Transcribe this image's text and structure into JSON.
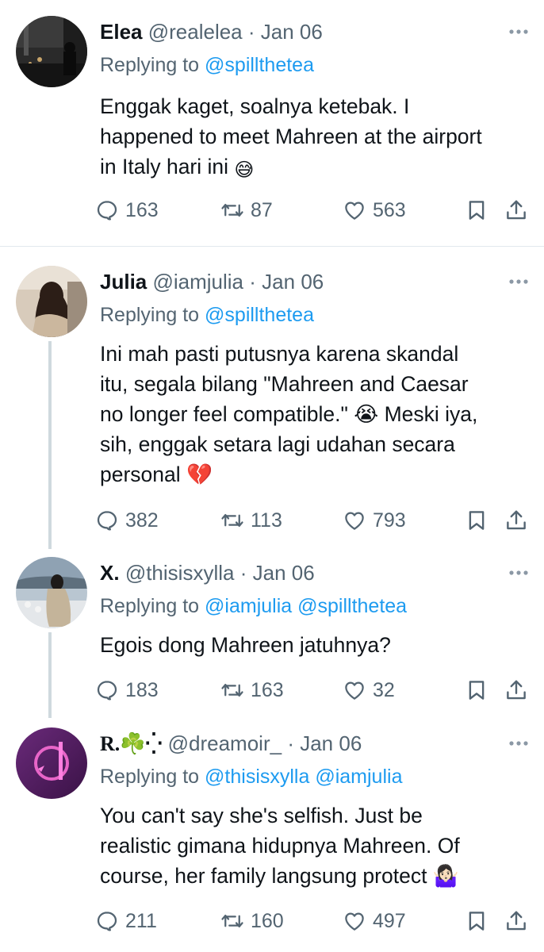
{
  "tweets": [
    {
      "name": "Elea",
      "handle": "@realelea",
      "sep": "·",
      "date": "Jan 06",
      "replying_label": "Replying to",
      "mentions": [
        "@spillthetea"
      ],
      "text_lines": [
        "Enggak kaget, soalnya ketebak. I",
        "happened to meet Mahreen at the airport",
        "in Italy hari ini"
      ],
      "emoji": "😅",
      "replies": "163",
      "retweets": "87",
      "likes": "563"
    },
    {
      "name": "Julia",
      "handle": "@iamjulia",
      "sep": "·",
      "date": "Jan 06",
      "replying_label": "Replying to",
      "mentions": [
        "@spillthetea"
      ],
      "text_lines": [
        "Ini mah pasti putusnya karena skandal",
        "itu, segala bilang \"Mahreen and Caesar",
        "no longer feel compatible.\" 😭 Meski iya,",
        "sih, enggak setara lagi udahan secara",
        "personal 💔"
      ],
      "replies": "382",
      "retweets": "113",
      "likes": "793"
    },
    {
      "name": "X.",
      "handle": "@thisisxylla",
      "sep": "·",
      "date": "Jan 06",
      "replying_label": "Replying to",
      "mentions": [
        "@iamjulia",
        "@spillthetea"
      ],
      "text_lines": [
        "Egois dong Mahreen jatuhnya?"
      ],
      "replies": "183",
      "retweets": "163",
      "likes": "32"
    },
    {
      "name": "R.☘️⁛",
      "handle": "@dreamoir_",
      "sep": "·",
      "date": "Jan 06",
      "replying_label": "Replying to",
      "mentions": [
        "@thisisxylla",
        "@iamjulia"
      ],
      "text_lines": [
        "You can't say she's selfish. Just be",
        "realistic gimana hidupnya Mahreen. Of",
        "course, her family langsung protect 🤷🏻‍♀️"
      ],
      "replies": "211",
      "retweets": "160",
      "likes": "497"
    }
  ],
  "colors": {
    "accent": "#1d9bf0",
    "muted": "#536471",
    "thread_line": "#cfd9de"
  },
  "icons": [
    "reply-icon",
    "retweet-icon",
    "like-icon",
    "bookmark-icon",
    "share-icon",
    "more-icon"
  ]
}
